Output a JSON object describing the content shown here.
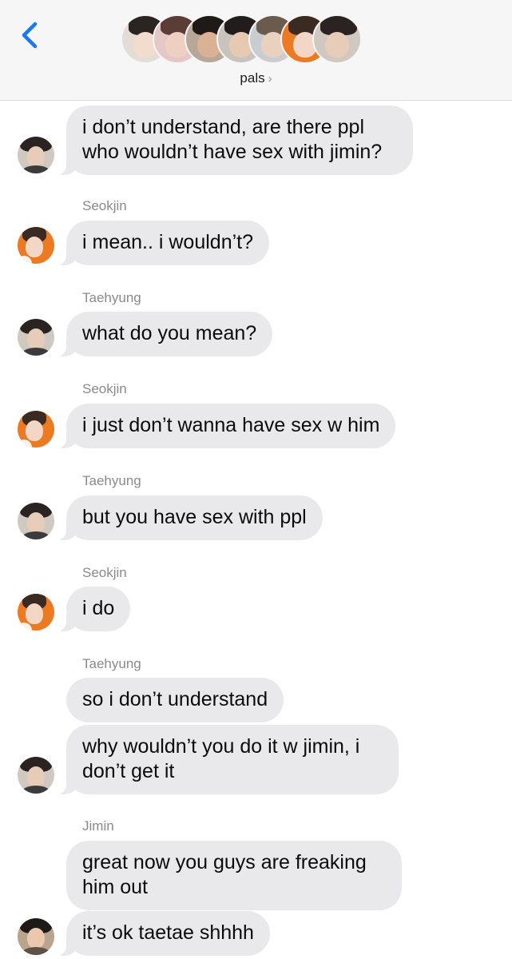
{
  "header": {
    "back_icon": "chevron-left-icon",
    "group_name": "pals",
    "chevron": "›",
    "group_avatars": [
      {
        "member": "member-1",
        "bg": "#e3ddd6",
        "hair": "#2a2422",
        "skin": "#f1dccd"
      },
      {
        "member": "member-2",
        "bg": "#e6c7c8",
        "hair": "#5a3d37",
        "skin": "#f0cfc3"
      },
      {
        "member": "member-3",
        "bg": "#b6a797",
        "hair": "#1f1a18",
        "skin": "#dbb195"
      },
      {
        "member": "member-4",
        "bg": "#c8c3bd",
        "hair": "#221d1c",
        "skin": "#e6c9b3"
      },
      {
        "member": "member-5",
        "bg": "#c9cdd2",
        "hair": "#6b5a4e",
        "skin": "#e9d0bf"
      },
      {
        "member": "member-6",
        "bg": "#ec7a22",
        "hair": "#3a2a22",
        "skin": "#f2d6c6"
      },
      {
        "member": "member-7",
        "bg": "#cfc9c1",
        "hair": "#2b2321",
        "skin": "#e7cdb9"
      }
    ]
  },
  "thread": {
    "m1": "i don’t understand, are there ppl who wouldn’t have sex with jimin?",
    "s1": "Seokjin",
    "m2": "i mean.. i wouldn’t?",
    "s2": "Taehyung",
    "m3": "what do you mean?",
    "s3": "Seokjin",
    "m4": "i just don’t wanna have sex w him",
    "s4": "Taehyung",
    "m5": "but you have sex with ppl",
    "s5": "Seokjin",
    "m6": "i do",
    "s6": "Taehyung",
    "m7": "so i don’t understand",
    "m8": "why wouldn’t you do it w jimin, i don’t get it",
    "s7": "Jimin",
    "m9": "great now you guys are freaking him out",
    "m10": "it’s ok taetae shhhh"
  }
}
